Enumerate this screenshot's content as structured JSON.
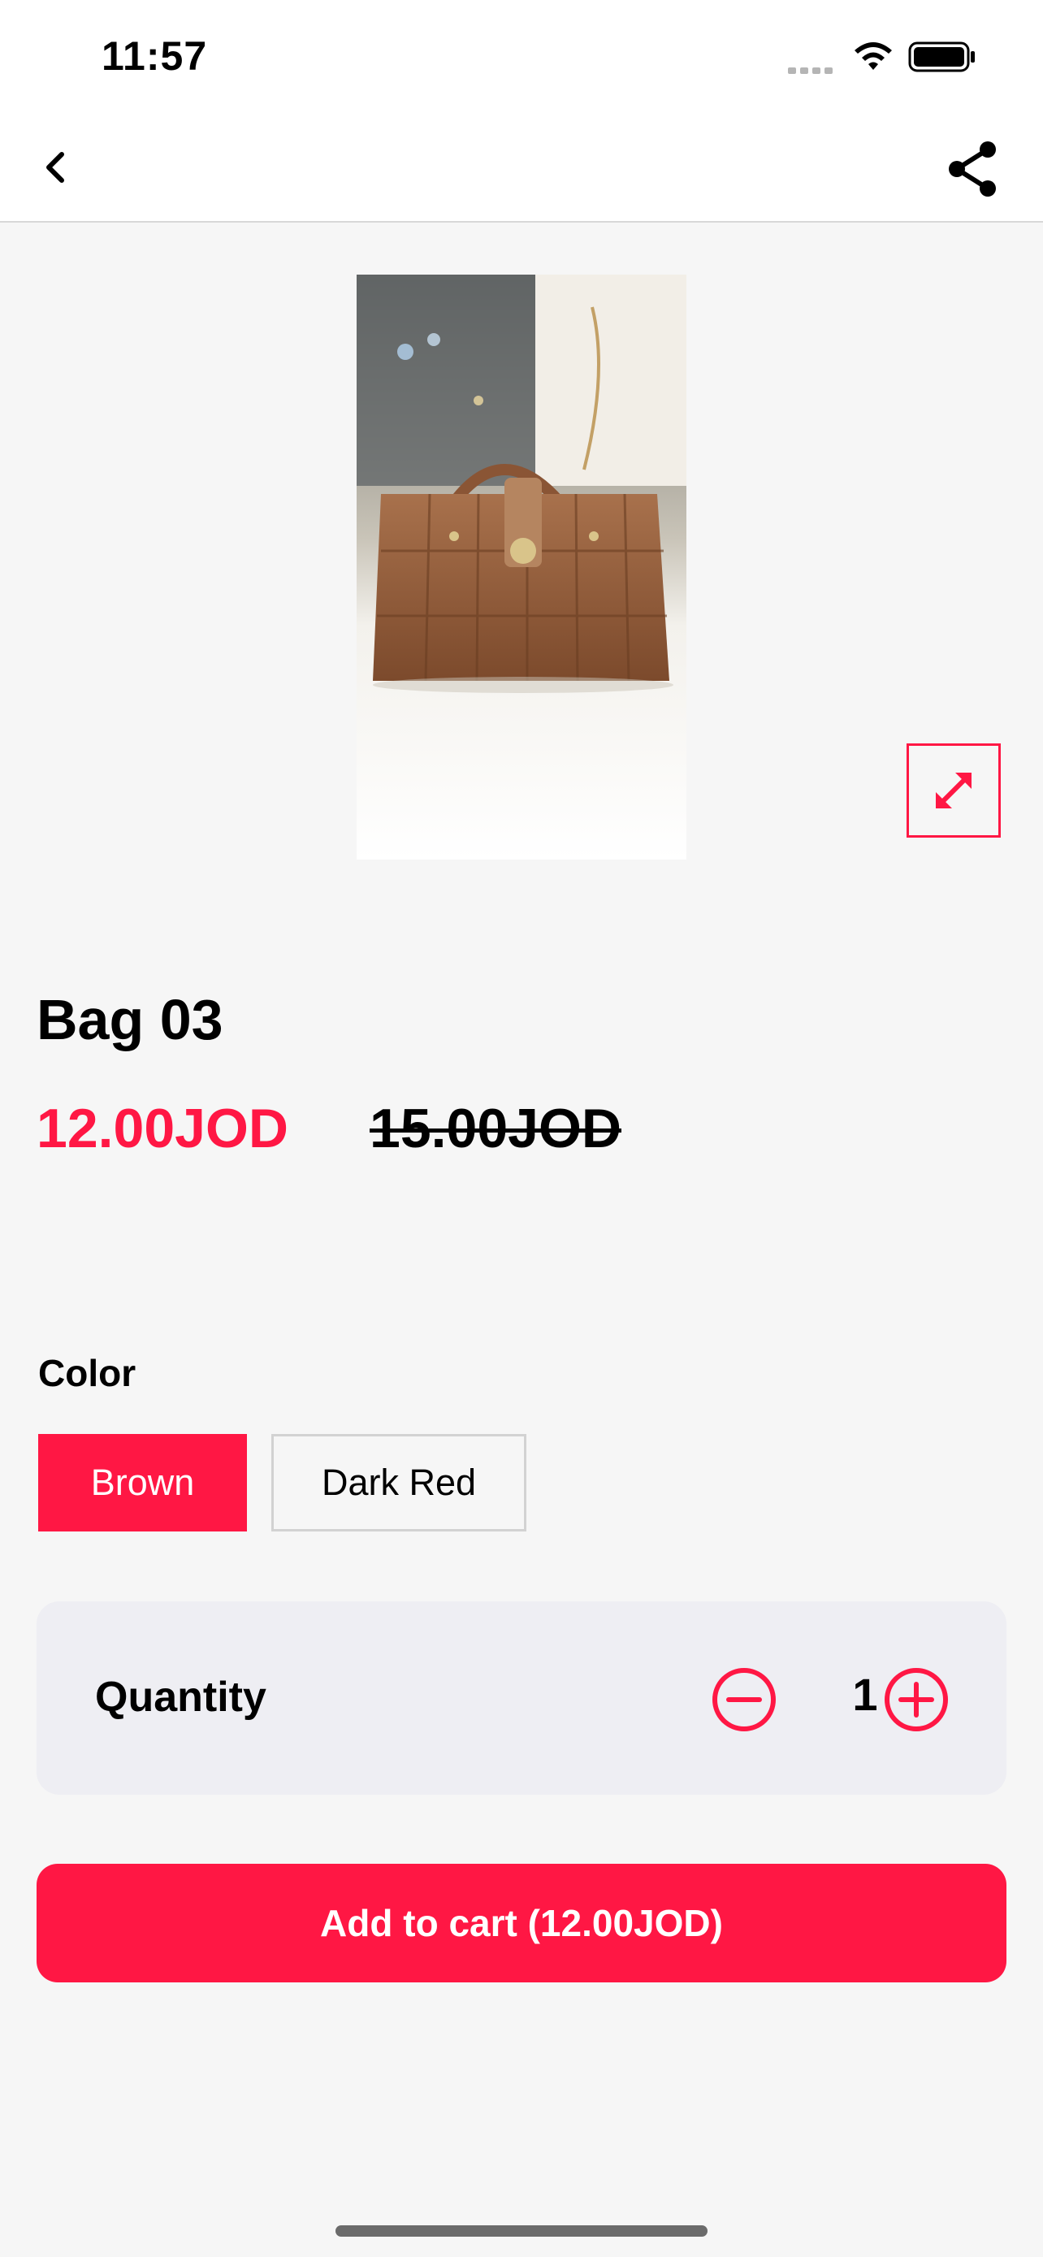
{
  "status_bar": {
    "time": "11:57"
  },
  "nav": {
    "back_icon": "chevron-left-icon",
    "share_icon": "share-icon"
  },
  "product": {
    "title": "Bag 03",
    "price": "12.00JOD",
    "old_price": "15.00JOD",
    "image_description": "brown-quilted-handbag-photo"
  },
  "color": {
    "label": "Color",
    "options": [
      "Brown",
      "Dark Red"
    ],
    "selected": "Brown"
  },
  "quantity": {
    "label": "Quantity",
    "value": "1"
  },
  "cart": {
    "label": "Add to cart (12.00JOD)"
  },
  "colors": {
    "accent": "#ff1744",
    "background": "#f6f6f6",
    "card": "#eeeef3"
  }
}
